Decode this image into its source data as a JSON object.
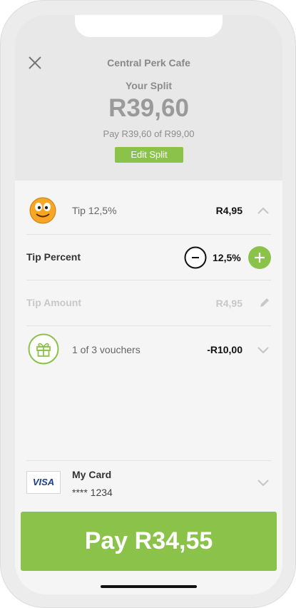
{
  "header": {
    "merchant": "Central Perk Cafe",
    "split_label": "Your Split",
    "split_amount": "R39,60",
    "split_sub": "Pay R39,60 of R99,00",
    "edit_split_label": "Edit Split"
  },
  "tip_row": {
    "label": "Tip 12,5%",
    "value": "R4,95"
  },
  "tip_percent": {
    "label": "Tip Percent",
    "value": "12,5%"
  },
  "tip_amount": {
    "label": "Tip Amount",
    "value": "R4,95"
  },
  "vouchers": {
    "label": "1 of 3 vouchers",
    "value": "-R10,00"
  },
  "card": {
    "brand": "VISA",
    "name": "My Card",
    "number": "**** 1234"
  },
  "pay_button": {
    "label": "Pay R34,55"
  },
  "colors": {
    "accent": "#8bc34a"
  }
}
